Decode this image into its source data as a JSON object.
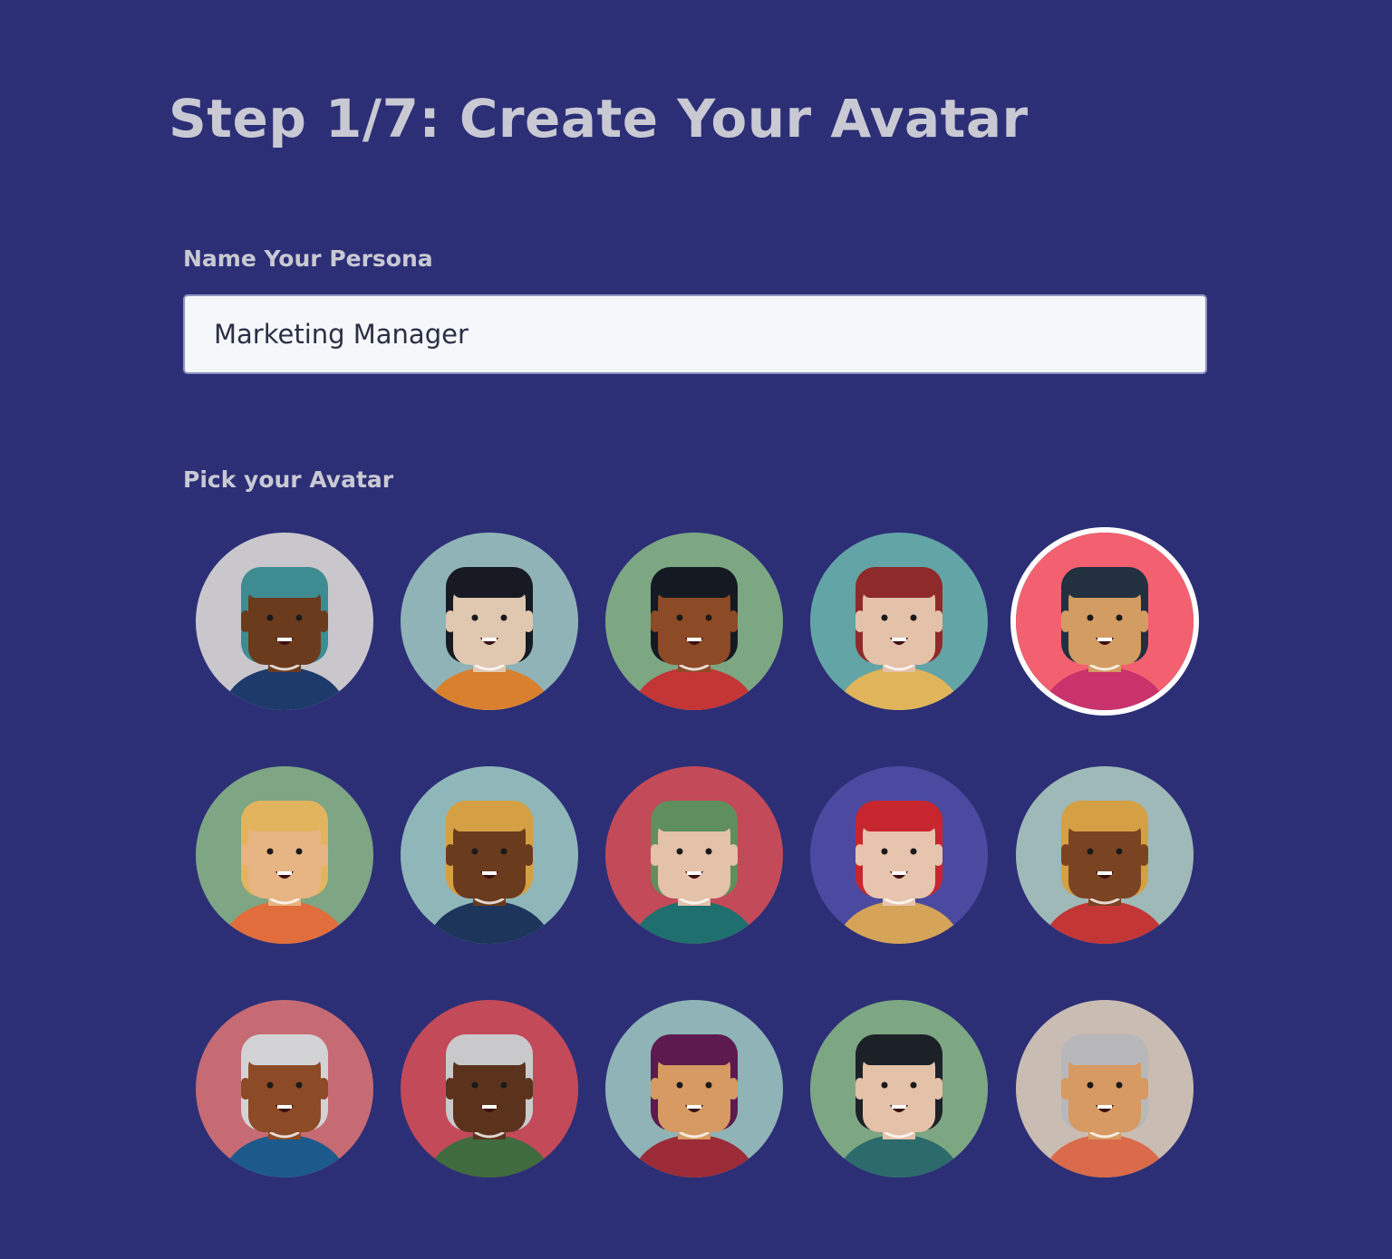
{
  "header": {
    "title": "Step 1/7: Create Your Avatar"
  },
  "persona": {
    "label": "Name Your Persona",
    "value": "Marketing Manager"
  },
  "avatar_picker": {
    "label": "Pick your Avatar",
    "selected_index": 4,
    "avatars": [
      {
        "bg": "#c9c7cc",
        "skin": "#6b3b1e",
        "hair": "#3d8c91",
        "shirt": "#1e3a6b",
        "icon": "avatar-beanie-man-icon"
      },
      {
        "bg": "#8fb3b6",
        "skin": "#e0c7b0",
        "hair": "#171a22",
        "shirt": "#d9802f",
        "icon": "avatar-bangs-woman-icon"
      },
      {
        "bg": "#7da683",
        "skin": "#8c4a26",
        "hair": "#151a22",
        "shirt": "#c23636",
        "icon": "avatar-curly-woman-icon"
      },
      {
        "bg": "#63a4a6",
        "skin": "#e4c1a9",
        "hair": "#8f2a2a",
        "shirt": "#e0b45a",
        "icon": "avatar-redhead-man-icon"
      },
      {
        "bg": "#f36171",
        "skin": "#d29c62",
        "hair": "#22303f",
        "shirt": "#c8336b",
        "icon": "avatar-dark-hair-man-icon"
      },
      {
        "bg": "#7ea584",
        "skin": "#e7b483",
        "hair": "#e2b45e",
        "shirt": "#e06d3b",
        "icon": "avatar-blonde-woman-icon"
      },
      {
        "bg": "#8fb7ba",
        "skin": "#6b3b1e",
        "hair": "#d4a043",
        "shirt": "#1d355a",
        "icon": "avatar-flat-top-man-icon"
      },
      {
        "bg": "#c34a58",
        "skin": "#e4c1a9",
        "hair": "#5f8f5c",
        "shirt": "#1f6f6e",
        "icon": "avatar-mustache-man-icon"
      },
      {
        "bg": "#4b4aa0",
        "skin": "#e7c4ad",
        "hair": "#c7262e",
        "shirt": "#d6a458",
        "icon": "avatar-red-ponytail-woman-icon"
      },
      {
        "bg": "#9fb9b8",
        "skin": "#7a4322",
        "hair": "#d4a043",
        "shirt": "#c23636",
        "icon": "avatar-cap-glasses-man-icon"
      },
      {
        "bg": "#c66b73",
        "skin": "#8c4a26",
        "hair": "#d3d3d6",
        "shirt": "#1d5a8c",
        "icon": "avatar-gray-hair-woman-icon"
      },
      {
        "bg": "#c34a58",
        "skin": "#5b321c",
        "hair": "#c9c9cc",
        "shirt": "#3f6b3f",
        "icon": "avatar-white-beard-man-icon"
      },
      {
        "bg": "#8fb3b6",
        "skin": "#d69a62",
        "hair": "#5c1a4f",
        "shirt": "#9b2c37",
        "icon": "avatar-glasses-woman-icon"
      },
      {
        "bg": "#7da683",
        "skin": "#e4c1a9",
        "hair": "#1c2127",
        "shirt": "#2c6a6c",
        "icon": "avatar-goatee-man-icon"
      },
      {
        "bg": "#c9bcb2",
        "skin": "#d69a62",
        "hair": "#b8b8bb",
        "shirt": "#d96a4a",
        "icon": "avatar-bald-man-icon"
      }
    ]
  }
}
